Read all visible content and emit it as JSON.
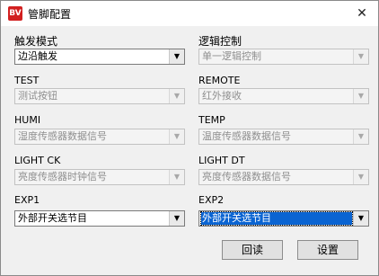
{
  "window": {
    "title": "管脚配置",
    "icon_text": "BV",
    "close_symbol": "✕"
  },
  "fields": {
    "trigger_mode": {
      "label": "触发模式",
      "value": "边沿触发"
    },
    "logic_control": {
      "label": "逻辑控制",
      "value": "单一逻辑控制"
    },
    "test": {
      "label": "TEST",
      "value": "测试按钮"
    },
    "remote": {
      "label": "REMOTE",
      "value": "红外接收"
    },
    "humi": {
      "label": "HUMI",
      "value": "湿度传感器数据信号"
    },
    "temp": {
      "label": "TEMP",
      "value": "温度传感器数据信号"
    },
    "light_ck": {
      "label": "LIGHT CK",
      "value": "亮度传感器时钟信号"
    },
    "light_dt": {
      "label": "LIGHT DT",
      "value": "亮度传感器数据信号"
    },
    "exp1": {
      "label": "EXP1",
      "value": "外部开关选节目"
    },
    "exp2": {
      "label": "EXP2",
      "value": "外部开关选节目"
    }
  },
  "buttons": {
    "read": "回读",
    "set": "设置"
  },
  "icons": {
    "dropdown": "chevron-down-icon",
    "close": "close-icon",
    "app": "app-icon"
  },
  "colors": {
    "focus_highlight": "#0a64d2",
    "app_icon": "#d21f1f",
    "disabled_text": "#8f8f8f"
  }
}
